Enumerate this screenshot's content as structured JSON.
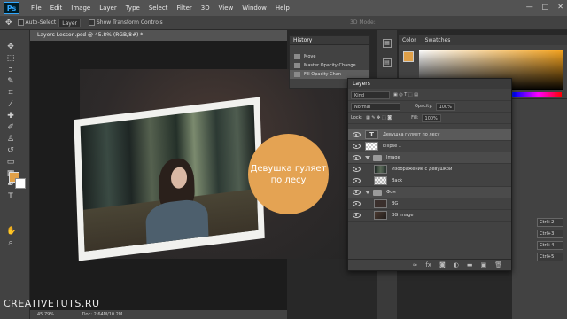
{
  "menubar": {
    "logo": "Ps",
    "items": [
      "File",
      "Edit",
      "Image",
      "Layer",
      "Type",
      "Select",
      "Filter",
      "3D",
      "View",
      "Window",
      "Help"
    ],
    "controls": [
      "—",
      "□",
      "✕"
    ]
  },
  "options": {
    "auto_select_label": "Auto-Select",
    "auto_select_value": "Layer",
    "show_transform": "Show Transform Controls",
    "mode_3d": "3D Mode:"
  },
  "document": {
    "tab": "Layers Lesson.psd @ 45.8% (RGB/8#) *",
    "zoom": "45.79%",
    "doc_size": "Doc: 2.64M/10.2M"
  },
  "canvas": {
    "circle_line1": "Девушка гуляет",
    "circle_line2": "по лесу"
  },
  "watermark": "CREATIVETUTS.RU",
  "history": {
    "title": "History",
    "items": [
      {
        "label": "Move"
      },
      {
        "label": "Master Opacity Change"
      },
      {
        "label": "Fill Opacity Chan"
      }
    ]
  },
  "color": {
    "tab_color": "Color",
    "tab_swatches": "Swatches",
    "foreground": "#e0a048"
  },
  "layers_panel": {
    "title": "Layers",
    "filter": "Kind",
    "blend_mode": "Normal",
    "opacity_label": "Opacity:",
    "opacity": "100%",
    "lock_label": "Lock:",
    "fill_label": "Fill:",
    "fill": "100%",
    "layers": [
      {
        "name": "Девушка гуляет  по лесу",
        "kind": "text",
        "selected": true
      },
      {
        "name": "Ellipse 1",
        "kind": "shape"
      },
      {
        "name": "Image",
        "kind": "group"
      },
      {
        "name": "Изображение с девушкой",
        "kind": "image"
      },
      {
        "name": "Back",
        "kind": "pixel"
      },
      {
        "name": "Фон",
        "kind": "group"
      },
      {
        "name": "BG",
        "kind": "pixel"
      },
      {
        "name": "BG Image",
        "kind": "image"
      }
    ]
  },
  "shortcuts": [
    "Ctrl+2",
    "Ctrl+3",
    "Ctrl+4",
    "Ctrl+5"
  ]
}
